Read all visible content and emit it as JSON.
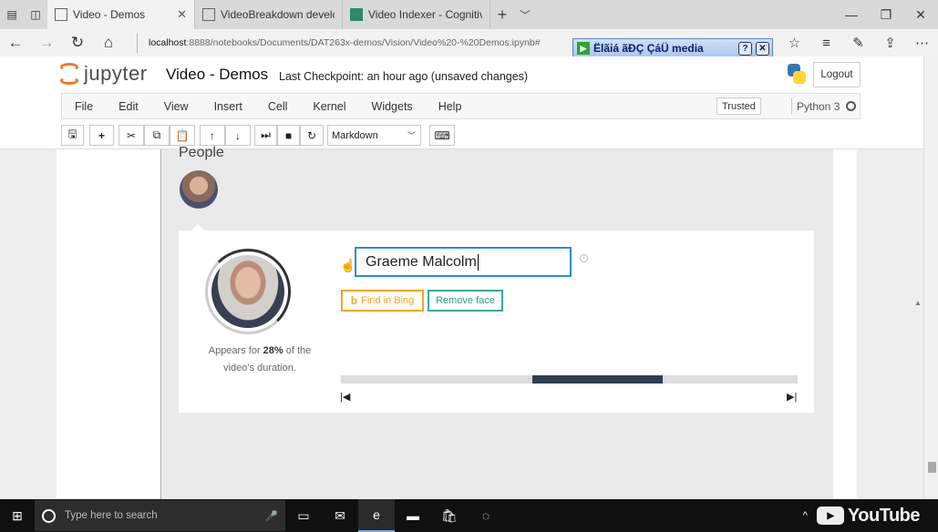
{
  "browser": {
    "tabs": [
      {
        "title": "Video - Demos",
        "active": true
      },
      {
        "title": "VideoBreakdown developer",
        "active": false
      },
      {
        "title": "Video Indexer - Cognitive V",
        "active": false
      }
    ],
    "url_host": "localhost",
    "url_path": ":8888/notebooks/Documents/DAT263x-demos/Vision/Video%20-%20Demos.ipynb#"
  },
  "media_overlay": {
    "label": "Ëlãiá ãĐÇ ÇáÜ media"
  },
  "jupyter": {
    "logo_text": "jupyter",
    "notebook_title": "Video - Demos",
    "checkpoint": "Last Checkpoint: an hour ago (unsaved changes)",
    "logout_label": "Logout",
    "menus": [
      "File",
      "Edit",
      "View",
      "Insert",
      "Cell",
      "Kernel",
      "Widgets",
      "Help"
    ],
    "trusted_label": "Trusted",
    "kernel_label": "Python 3",
    "cell_type": "Markdown"
  },
  "people": {
    "heading": "People",
    "person_name": "Graeme Malcolm",
    "appears_prefix": "Appears for ",
    "appears_percent": "28%",
    "appears_suffix": " of the video's duration.",
    "find_in_bing": "Find in Bing",
    "remove_face": "Remove face",
    "timeline_segments": [
      {
        "start_pct": 42,
        "end_pct": 70.5
      }
    ]
  },
  "taskbar": {
    "search_placeholder": "Type here to search",
    "watermark": "YouTube"
  },
  "colors": {
    "bing_orange": "#f5a623",
    "remove_teal": "#3aa89a",
    "name_border": "#2f8ed4",
    "segment": "#2c3e50",
    "jupyter_orange": "#f37726"
  },
  "icons": [
    "task-view-icon",
    "tab-aside-icon",
    "back-icon",
    "forward-icon",
    "refresh-icon",
    "home-icon",
    "favorite-icon",
    "hub-icon",
    "notes-icon",
    "share-icon",
    "more-icon",
    "save-icon",
    "add-cell-icon",
    "cut-icon",
    "copy-icon",
    "paste-icon",
    "move-up-icon",
    "move-down-icon",
    "run-icon",
    "stop-icon",
    "restart-icon",
    "keyboard-icon"
  ]
}
